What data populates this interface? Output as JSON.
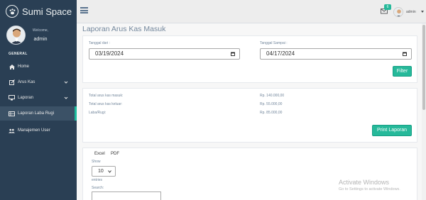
{
  "sidebar": {
    "brand": "Sumi Space",
    "welcome": "Welcome,",
    "username": "admin",
    "section": "GENERAL",
    "items": [
      {
        "label": "Home",
        "icon": "home-icon"
      },
      {
        "label": "Arus Kas",
        "icon": "edit-icon"
      },
      {
        "label": "Laporan",
        "icon": "desktop-icon"
      },
      {
        "label": "Laporan Laba Rugi",
        "icon": "table-icon",
        "active": true
      },
      {
        "label": "Manajemen User",
        "icon": "users-icon"
      }
    ]
  },
  "topnav": {
    "notification_count": "6",
    "user": "admin"
  },
  "page": {
    "title": "Laporan Arus Kas Masuk"
  },
  "filter": {
    "from_label": "Tanggal dari :",
    "from_value": "03/19/2024",
    "to_label": "Tanggal Sampai :",
    "to_value": "04/17/2024",
    "button": "Filter"
  },
  "summary": {
    "rows": [
      {
        "label": "Total arus kas masuk:",
        "value": "Rp. 140.000,00"
      },
      {
        "label": "Total arus kas keluar:",
        "value": "Rp. 55.000,00"
      },
      {
        "label": "Laba/Rugi:",
        "value": "Rp. 85.000,00"
      }
    ],
    "print_button": "Print Laporan"
  },
  "table_controls": {
    "export_excel": "Excel",
    "export_pdf": "PDF",
    "show_label": "Show",
    "entries_value": "10",
    "entries_label": "entries",
    "search_label": "Search:"
  },
  "watermark": {
    "title": "Activate Windows",
    "subtitle": "Go to Settings to activate Windows."
  },
  "colors": {
    "sidebar": "#2a3f54",
    "accent": "#26b99a",
    "active_border": "#1abb9c"
  }
}
